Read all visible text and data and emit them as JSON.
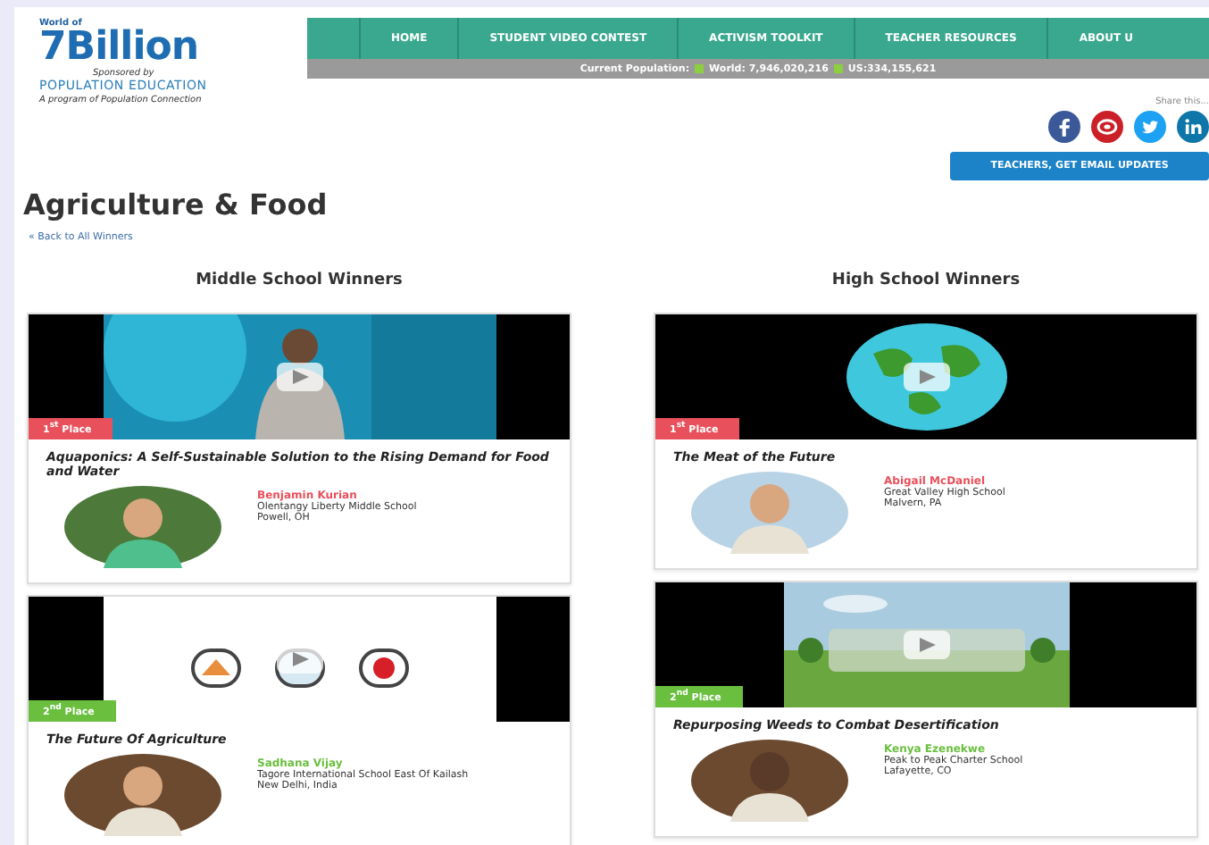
{
  "logo": {
    "top": "World of",
    "brand": "7Billion",
    "sponsor": "Sponsored by",
    "org": "POPULATION EDUCATION",
    "tagline": "A program of Population Connection"
  },
  "nav": {
    "items": [
      {
        "label": "HOME",
        "selected": false
      },
      {
        "label": "STUDENT VIDEO CONTEST",
        "selected": false
      },
      {
        "label": "ACTIVISM TOOLKIT",
        "selected": false
      },
      {
        "label": "TEACHER RESOURCES",
        "selected": false
      },
      {
        "label": "ABOUT U",
        "selected": false
      }
    ]
  },
  "population": {
    "label": "Current Population:",
    "world": "World: **7,946,020,216**",
    "us": "US:**334,155,621**"
  },
  "share": {
    "label": "Share this...",
    "icons": [
      {
        "kind": "facebook",
        "color": "#3b5998"
      },
      {
        "kind": "pinterest",
        "color": "#cb2027"
      },
      {
        "kind": "twitter",
        "color": "#1da1f2"
      },
      {
        "kind": "linkedin",
        "color": "#0e76a8"
      }
    ]
  },
  "email_button": "TEACHERS, GET EMAIL UPDATES",
  "title": "Agriculture & Food",
  "back_link": "« Back to All Winners",
  "columns": [
    {
      "heading": "Middle School Winners",
      "entries": [
        {
          "kind": "person",
          "place": "1$^{st}$ Place",
          "color": "#e8505b",
          "title": "Aquaponics: A Self-Sustainable Solution to the Rising Demand for Food and Water",
          "name": "Benjamin Kurian",
          "school": "Olentangy Liberty Middle School",
          "location": "Powell, OH"
        },
        {
          "kind": "icons",
          "place": "2$^{nd}$ Place",
          "color": "#6abf3f",
          "title": "The Future Of Agriculture",
          "name": "Sadhana Vijay",
          "school": "Tagore International School East Of Kailash",
          "location": "New Delhi, India"
        }
      ]
    },
    {
      "heading": "High School Winners",
      "entries": [
        {
          "kind": "globe",
          "place": "1$^{st}$ Place",
          "color": "#e8505b",
          "title": "The Meat of the Future",
          "name": "Abigail McDaniel",
          "school": "Great Valley High School",
          "location": "Malvern, PA"
        },
        {
          "kind": "landscape",
          "place": "2$^{nd}$ Place",
          "color": "#6abf3f",
          "title": "Repurposing Weeds to Combat Desertification",
          "name": "Kenya Ezenekwe",
          "school": "Peak to Peak Charter School",
          "location": "Lafayette, CO"
        }
      ]
    }
  ]
}
